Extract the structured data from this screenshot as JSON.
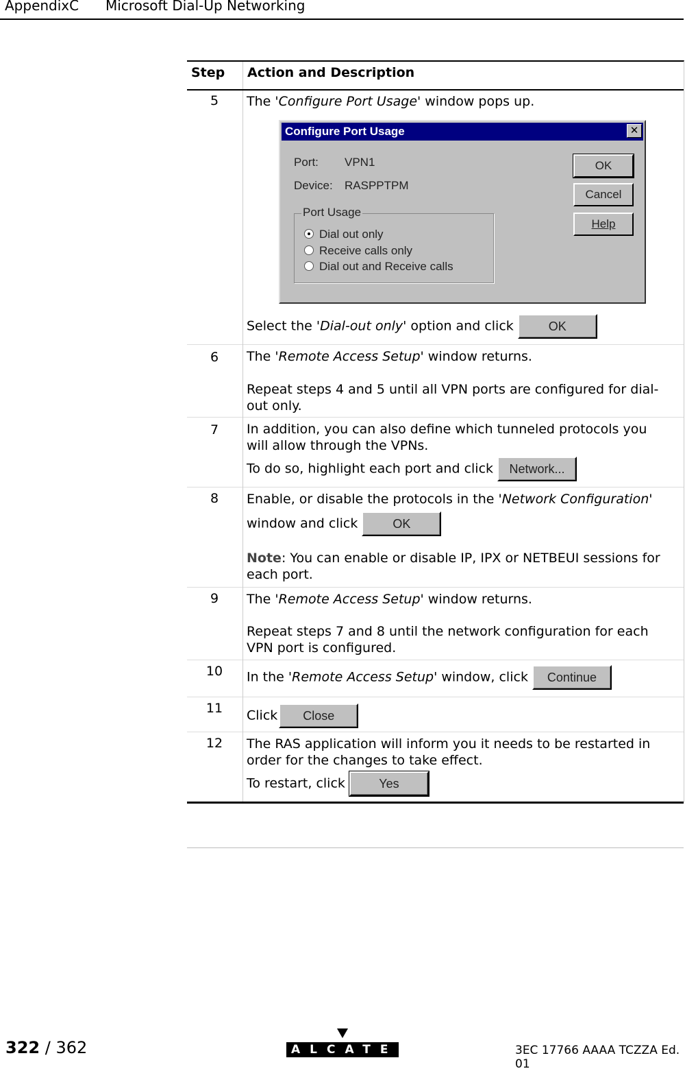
{
  "header": {
    "section": "AppendixC",
    "title": "Microsoft Dial-Up Networking"
  },
  "table": {
    "col_step": "Step",
    "col_action": "Action and Description"
  },
  "dialog": {
    "title": "Configure Port Usage",
    "port_label": "Port:",
    "port_value": "VPN1",
    "device_label": "Device:",
    "device_value": "RASPPTPM",
    "group": "Port Usage",
    "options": [
      {
        "label": "Dial out only",
        "selected": true
      },
      {
        "label": "Receive calls only",
        "selected": false
      },
      {
        "label": "Dial out and Receive calls",
        "selected": false
      }
    ],
    "ok": "OK",
    "cancel": "Cancel",
    "help": "Help"
  },
  "rows": [
    {
      "step": "5",
      "l1a": "The '",
      "l1i": "Configure Port Usage",
      "l1b": "' window pops up.",
      "l2a": "Select the '",
      "l2i": "Dial-out only",
      "l2b": "' option and click",
      "btn": "OK"
    },
    {
      "step": "6",
      "l1a": "The '",
      "l1i": "Remote Access Setup",
      "l1b": "' window returns.",
      "l2": "Repeat steps 4 and 5 until all VPN ports are configured for dial-out only."
    },
    {
      "step": "7",
      "l1": "In addition, you can also define which tunneled protocols you will allow through the VPNs.",
      "l2": "To do so, highlight each port and click",
      "btn": "Network..."
    },
    {
      "step": "8",
      "l1a": "Enable, or disable the protocols in the '",
      "l1i": "Network Configuration'",
      "l2": "window and click",
      "btn": "OK",
      "note_label": "Note",
      "note": ": You can enable or disable IP, IPX or NETBEUI sessions for each port."
    },
    {
      "step": "9",
      "l1a": "The '",
      "l1i": "Remote Access Setup",
      "l1b": "' window returns.",
      "l2": "Repeat steps 7 and 8 until the network configuration for each VPN port is configured."
    },
    {
      "step": "10",
      "l1a": "In the '",
      "l1i": "Remote Access Setup",
      "l1b": "' window, click",
      "btn": "Continue"
    },
    {
      "step": "11",
      "l1": "Click",
      "btn": "Close"
    },
    {
      "step": "12",
      "l1": "The RAS application will inform you it needs to be restarted in order for the changes to take effect.",
      "l2": "To restart, click",
      "btn": "Yes"
    }
  ],
  "footer": {
    "page": "322",
    "total": "/ 362",
    "logo": "ALCATEL",
    "doc_ref": "3EC 17766 AAAA TCZZA Ed. 01"
  }
}
